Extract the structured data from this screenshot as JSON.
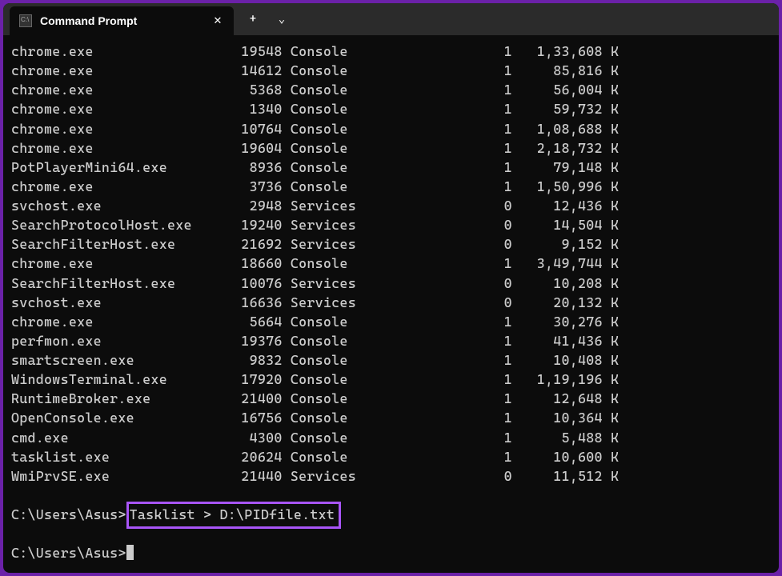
{
  "window": {
    "tab_title": "Command Prompt",
    "new_tab_icon": "+",
    "dropdown_icon": "⌄"
  },
  "tasklist": {
    "rows": [
      {
        "name": "chrome.exe",
        "pid": "19548",
        "session_name": "Console",
        "session_num": "1",
        "mem": "1,33,608 K"
      },
      {
        "name": "chrome.exe",
        "pid": "14612",
        "session_name": "Console",
        "session_num": "1",
        "mem": "85,816 K"
      },
      {
        "name": "chrome.exe",
        "pid": "5368",
        "session_name": "Console",
        "session_num": "1",
        "mem": "56,004 K"
      },
      {
        "name": "chrome.exe",
        "pid": "1340",
        "session_name": "Console",
        "session_num": "1",
        "mem": "59,732 K"
      },
      {
        "name": "chrome.exe",
        "pid": "10764",
        "session_name": "Console",
        "session_num": "1",
        "mem": "1,08,688 K"
      },
      {
        "name": "chrome.exe",
        "pid": "19604",
        "session_name": "Console",
        "session_num": "1",
        "mem": "2,18,732 K"
      },
      {
        "name": "PotPlayerMini64.exe",
        "pid": "8936",
        "session_name": "Console",
        "session_num": "1",
        "mem": "79,148 K"
      },
      {
        "name": "chrome.exe",
        "pid": "3736",
        "session_name": "Console",
        "session_num": "1",
        "mem": "1,50,996 K"
      },
      {
        "name": "svchost.exe",
        "pid": "2948",
        "session_name": "Services",
        "session_num": "0",
        "mem": "12,436 K"
      },
      {
        "name": "SearchProtocolHost.exe",
        "pid": "19240",
        "session_name": "Services",
        "session_num": "0",
        "mem": "14,504 K"
      },
      {
        "name": "SearchFilterHost.exe",
        "pid": "21692",
        "session_name": "Services",
        "session_num": "0",
        "mem": "9,152 K"
      },
      {
        "name": "chrome.exe",
        "pid": "18660",
        "session_name": "Console",
        "session_num": "1",
        "mem": "3,49,744 K"
      },
      {
        "name": "SearchFilterHost.exe",
        "pid": "10076",
        "session_name": "Services",
        "session_num": "0",
        "mem": "10,208 K"
      },
      {
        "name": "svchost.exe",
        "pid": "16636",
        "session_name": "Services",
        "session_num": "0",
        "mem": "20,132 K"
      },
      {
        "name": "chrome.exe",
        "pid": "5664",
        "session_name": "Console",
        "session_num": "1",
        "mem": "30,276 K"
      },
      {
        "name": "perfmon.exe",
        "pid": "19376",
        "session_name": "Console",
        "session_num": "1",
        "mem": "41,436 K"
      },
      {
        "name": "smartscreen.exe",
        "pid": "9832",
        "session_name": "Console",
        "session_num": "1",
        "mem": "10,408 K"
      },
      {
        "name": "WindowsTerminal.exe",
        "pid": "17920",
        "session_name": "Console",
        "session_num": "1",
        "mem": "1,19,196 K"
      },
      {
        "name": "RuntimeBroker.exe",
        "pid": "21400",
        "session_name": "Console",
        "session_num": "1",
        "mem": "12,648 K"
      },
      {
        "name": "OpenConsole.exe",
        "pid": "16756",
        "session_name": "Console",
        "session_num": "1",
        "mem": "10,364 K"
      },
      {
        "name": "cmd.exe",
        "pid": "4300",
        "session_name": "Console",
        "session_num": "1",
        "mem": "5,488 K"
      },
      {
        "name": "tasklist.exe",
        "pid": "20624",
        "session_name": "Console",
        "session_num": "1",
        "mem": "10,600 K"
      },
      {
        "name": "WmiPrvSE.exe",
        "pid": "21440",
        "session_name": "Services",
        "session_num": "0",
        "mem": "11,512 K"
      }
    ]
  },
  "prompt1": {
    "path": "C:\\Users\\Asus>",
    "command": "Tasklist > D:\\PIDfile.txt"
  },
  "prompt2": {
    "path": "C:\\Users\\Asus>"
  }
}
